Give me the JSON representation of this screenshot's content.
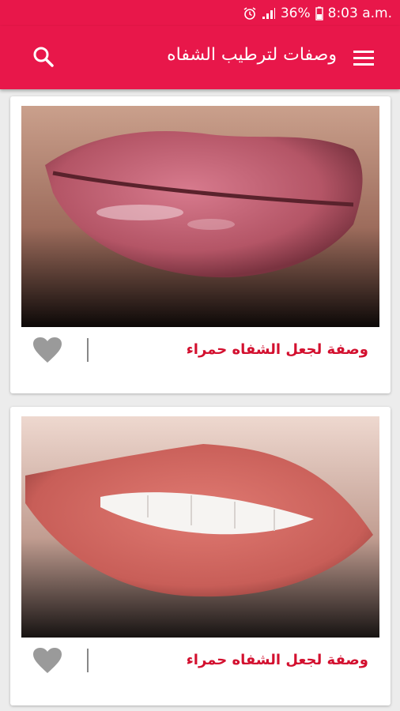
{
  "status_bar": {
    "battery": "36%",
    "time": "8:03 a.m."
  },
  "app_bar": {
    "title": "وصفات لترطيب الشفاه",
    "menu_icon": "hamburger-menu-icon",
    "search_icon": "search-icon"
  },
  "colors": {
    "primary": "#e8174a",
    "title_red": "#d3102f",
    "background": "#ececec"
  },
  "cards": [
    {
      "title": "وصفة لجعل الشفاه حمراء",
      "image": "glossy pink lips photo",
      "favorite_icon": "heart-icon"
    },
    {
      "title": "وصفة لجعل الشفاه حمراء",
      "image": "coral matte lips smiling photo",
      "favorite_icon": "heart-icon"
    }
  ]
}
